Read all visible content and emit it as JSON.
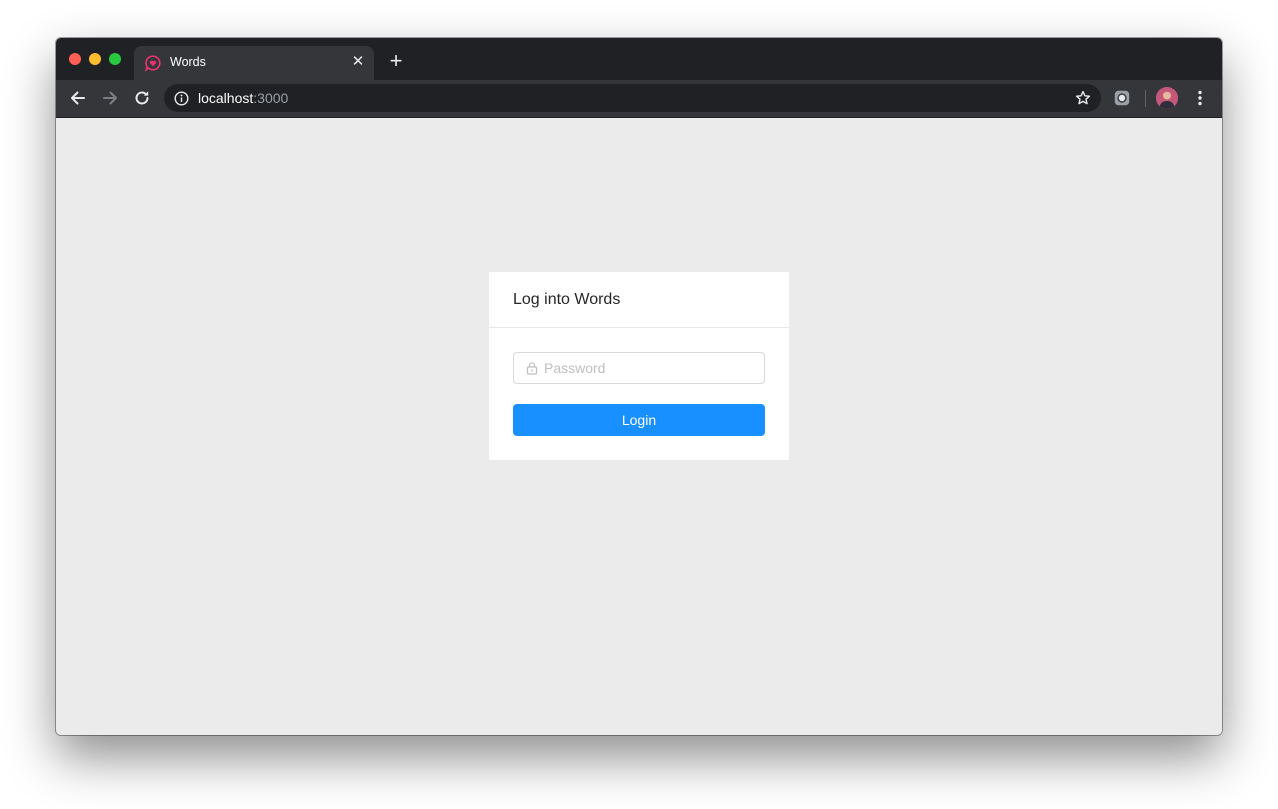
{
  "browser": {
    "tab": {
      "title": "Words",
      "favicon": "heart-chat-icon",
      "close_glyph": "✕"
    },
    "new_tab_glyph": "+",
    "address": {
      "host": "localhost",
      "port": ":3000"
    },
    "icons": {
      "back": "arrow-left-icon",
      "forward": "arrow-right-icon",
      "reload": "reload-icon",
      "info": "info-icon",
      "bookmark": "star-icon",
      "extension": "record-icon",
      "profile": "avatar",
      "menu": "kebab-menu-icon"
    }
  },
  "login": {
    "title": "Log into Words",
    "password_placeholder": "Password",
    "password_value": "",
    "button_label": "Login"
  },
  "colors": {
    "primary": "#1890ff",
    "favicon": "#e8336f",
    "page_background": "#ebebeb",
    "chrome_dark": "#202124",
    "chrome_toolbar": "#35363a"
  }
}
